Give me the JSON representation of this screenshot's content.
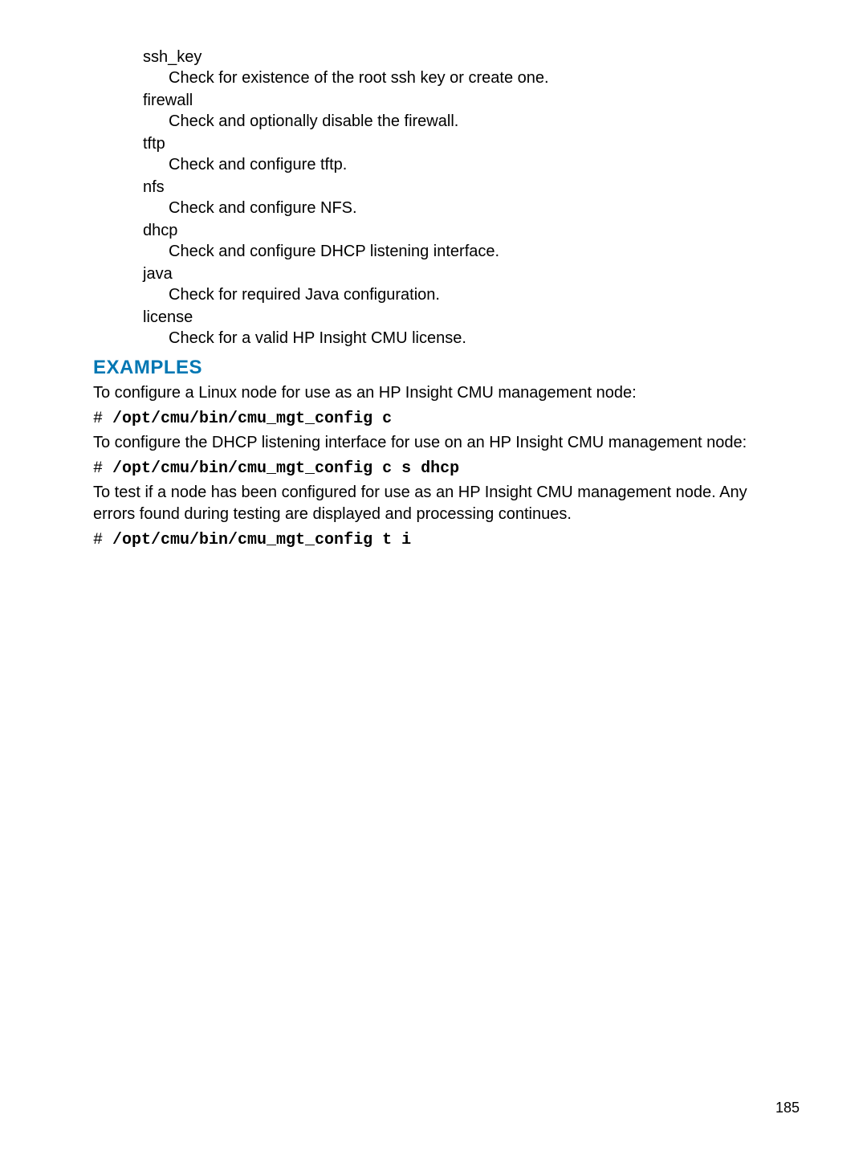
{
  "defs": [
    {
      "term": "ssh_key",
      "desc": "Check for existence of the root ssh key or create one."
    },
    {
      "term": "firewall",
      "desc": "Check and optionally disable the firewall."
    },
    {
      "term": "tftp",
      "desc": "Check and configure tftp."
    },
    {
      "term": "nfs",
      "desc": "Check and configure NFS."
    },
    {
      "term": "dhcp",
      "desc": "Check and configure DHCP listening interface."
    },
    {
      "term": "java",
      "desc": "Check for required Java configuration."
    },
    {
      "term": "license",
      "desc": "Check for a valid HP Insight CMU license."
    }
  ],
  "examples_heading": "EXAMPLES",
  "ex1_intro": "To configure a Linux node for use as an HP Insight CMU management node:",
  "ex1_prompt": "# ",
  "ex1_cmd": "/opt/cmu/bin/cmu_mgt_config c",
  "ex2_intro": "To configure the DHCP listening interface for use on an HP Insight CMU management node:",
  "ex2_prompt": "# ",
  "ex2_cmd": "/opt/cmu/bin/cmu_mgt_config c s dhcp",
  "ex3_intro": "To test if a node has been configured for use as an HP Insight CMU management node. Any errors found during testing are displayed and processing continues.",
  "ex3_prompt": "# ",
  "ex3_cmd": "/opt/cmu/bin/cmu_mgt_config t i",
  "page_number": "185"
}
